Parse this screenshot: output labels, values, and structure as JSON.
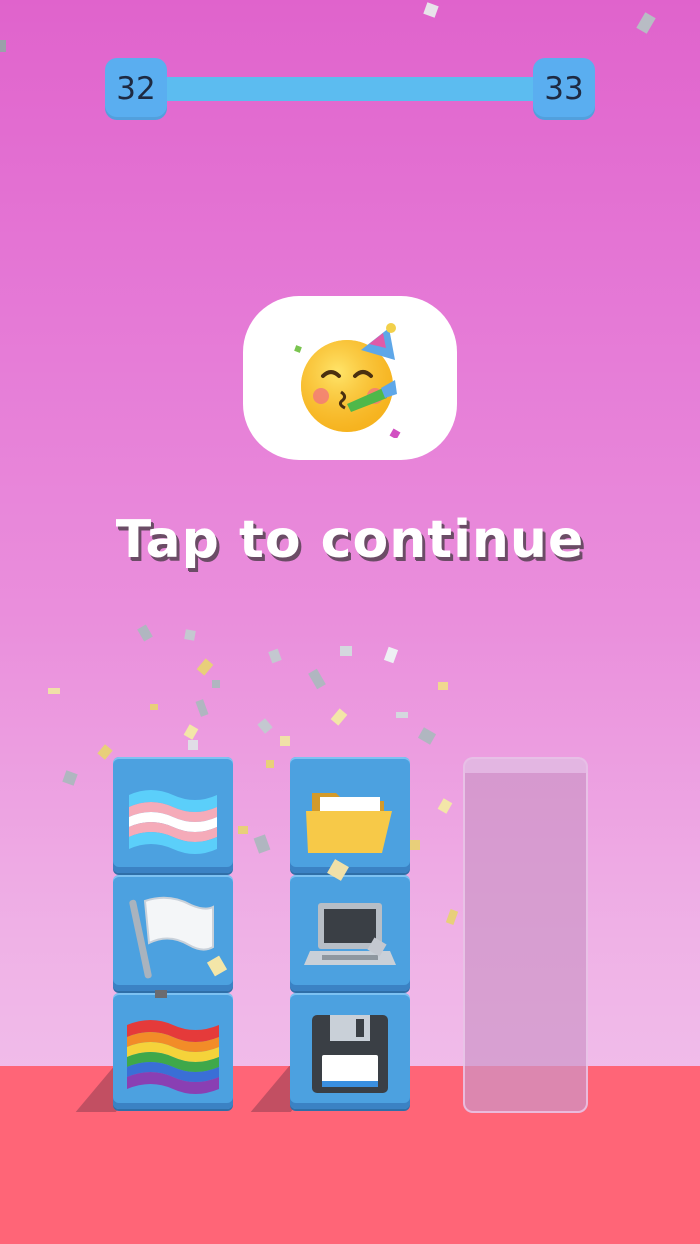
{
  "level": {
    "current": "32",
    "next": "33",
    "progress": 1.0
  },
  "result": {
    "emoji": "partying-face-icon"
  },
  "prompt": {
    "text": "Tap to continue"
  },
  "stacks": [
    {
      "name": "stack-1",
      "tiles": [
        "transgender-flag-icon",
        "white-flag-icon",
        "rainbow-flag-icon"
      ]
    },
    {
      "name": "stack-2",
      "tiles": [
        "open-folder-icon",
        "laptop-icon",
        "floppy-disk-icon"
      ]
    },
    {
      "name": "stack-3",
      "tiles": []
    }
  ],
  "colors": {
    "tile": "#4ca1e0",
    "floor": "#ff6577",
    "track": "#5cbcf0"
  }
}
